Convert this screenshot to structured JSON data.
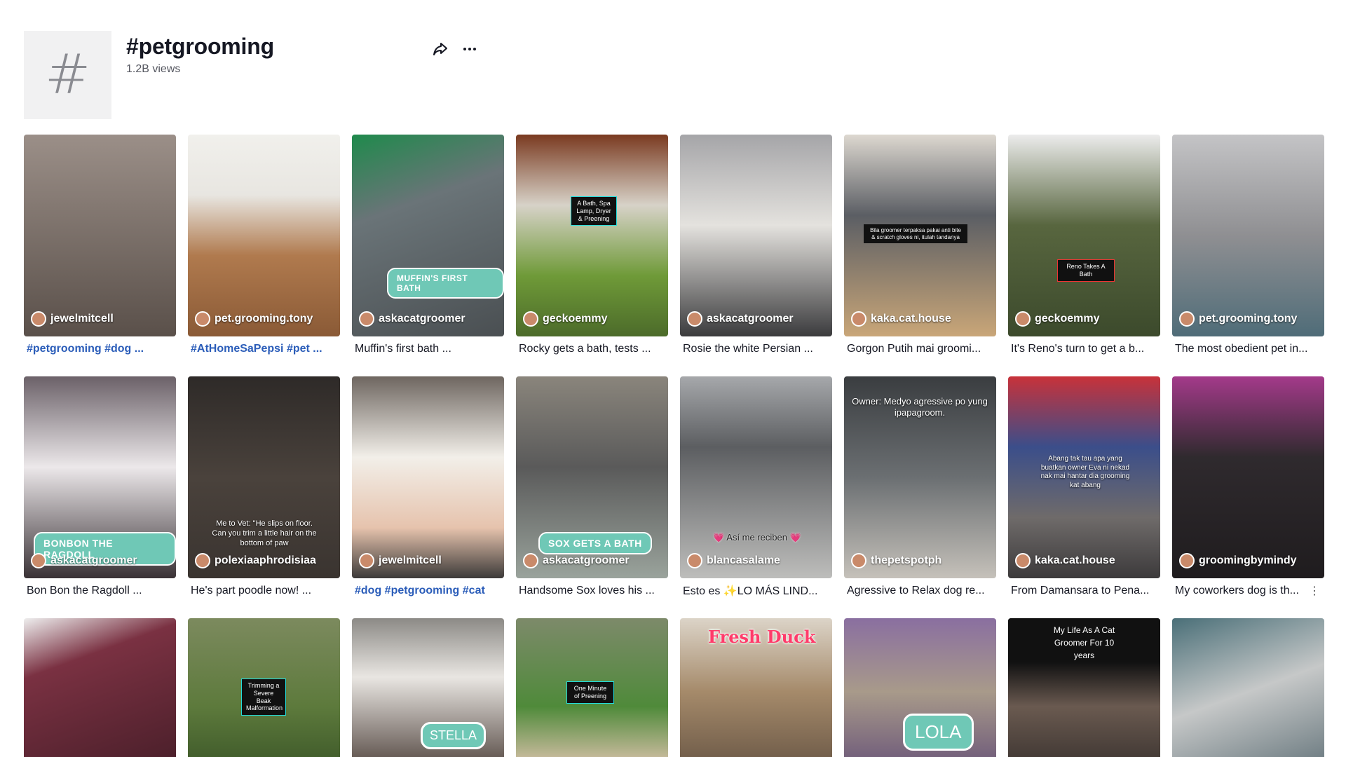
{
  "hashtag": {
    "title": "#petgrooming",
    "views": "1.2B views",
    "avatar_glyph": "#"
  },
  "icons": {
    "share": "share-icon",
    "more": "more-icon"
  },
  "videos_row1": [
    {
      "author": "jewelmitcell",
      "caption": "#petgrooming #dog ...",
      "caption_style": "hashtag",
      "bg": "#7a6e66"
    },
    {
      "author": "pet.grooming.tony",
      "caption": "#AtHomeSaPepsi #pet ...",
      "caption_style": "hashtag",
      "bg": "#b07a4e"
    },
    {
      "author": "askacatgroomer",
      "caption": "Muffin's first bath ...",
      "caption_style": "plain",
      "bg": "#5c6468",
      "overlay": "MUFFIN'S FIRST BATH"
    },
    {
      "author": "geckoemmy",
      "caption": "Rocky gets a bath, tests ...",
      "caption_style": "plain",
      "bg": "#5e8d3a",
      "overlay": "A Bath, Spa Lamp, Dryer & Preening"
    },
    {
      "author": "askacatgroomer",
      "caption": "Rosie the white Persian ...",
      "caption_style": "plain",
      "bg": "#7d7d80"
    },
    {
      "author": "kaka.cat.house",
      "caption": "Gorgon Putih mai groomi...",
      "caption_style": "plain",
      "bg": "#8d8274",
      "overlay": "Bila groomer terpaksa pakai anti bite & scratch gloves ni, itulah tandanya"
    },
    {
      "author": "geckoemmy",
      "caption": "It's Reno's turn to get a b...",
      "caption_style": "plain",
      "bg": "#5b6b45",
      "overlay": "Reno Takes A Bath"
    },
    {
      "author": "pet.grooming.tony",
      "caption": "The most obedient pet in...",
      "caption_style": "plain",
      "bg": "#8c8c90"
    }
  ],
  "videos_row2": [
    {
      "author": "askacatgroomer",
      "caption": "Bon Bon the Ragdoll ...",
      "caption_style": "plain",
      "bg": "#6a5d66",
      "overlay": "BONBON THE RAGDOLL"
    },
    {
      "author": "polexiaaphrodisiaa",
      "caption": "He's part poodle now! ...",
      "caption_style": "plain",
      "bg": "#3e3733",
      "overlay": "Me to Vet: \"He slips on floor. Can you trim a little hair on the bottom of paw"
    },
    {
      "author": "jewelmitcell",
      "caption": "#dog #petgrooming #cat",
      "caption_style": "hashtag",
      "bg": "#8a7f78"
    },
    {
      "author": "askacatgroomer",
      "caption": "Handsome Sox loves his ...",
      "caption_style": "plain",
      "bg": "#6f7068",
      "overlay": "SOX GETS A BATH"
    },
    {
      "author": "blancasalame",
      "caption": "Esto es ✨LO MÁS LIND...",
      "caption_style": "plain",
      "bg": "#7e7d7a",
      "overlay": "💗 Así me reciben 💗"
    },
    {
      "author": "thepetspotph",
      "caption": "Agressive to Relax dog re...",
      "caption_style": "plain",
      "bg": "#55595b",
      "overlay": "Owner: Medyo agressive po yung ipapagroom."
    },
    {
      "author": "kaka.cat.house",
      "caption": "From Damansara to Pena...",
      "caption_style": "plain",
      "bg": "#5d5a63",
      "overlay": "Abang tak tau apa yang buatkan owner Eva ni nekad nak mai hantar dia grooming kat abang"
    },
    {
      "author": "groomingbymindy",
      "caption": "My coworkers dog is th...",
      "caption_style": "plain",
      "bg": "#463f45",
      "has_menu": true
    }
  ],
  "videos_row3": [
    {
      "bg": "#6b3a46"
    },
    {
      "bg": "#6a7a4f",
      "overlay": "Trimming a Severe Beak Malformation"
    },
    {
      "bg": "#7a6e6a",
      "overlay": "STELLA"
    },
    {
      "bg": "#5f7d4a",
      "overlay": "One Minute of Preening"
    },
    {
      "bg": "#8b7560",
      "overlay": "Fresh Duck"
    },
    {
      "bg": "#6f5f78",
      "overlay": "LOLA"
    },
    {
      "bg": "#4b4442",
      "overlay": "My Life As A Cat Groomer For 10 years"
    },
    {
      "bg": "#6e7b80"
    }
  ]
}
